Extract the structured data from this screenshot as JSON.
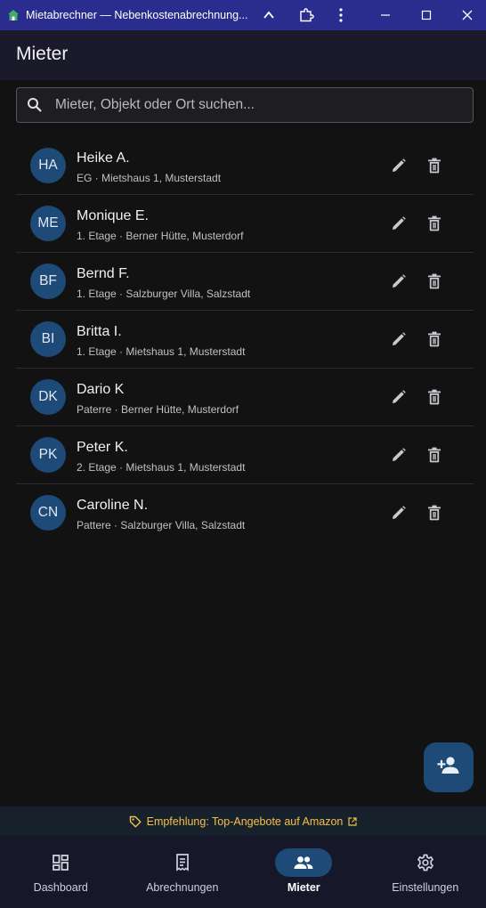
{
  "window": {
    "title": "Mietabrechner — Nebenkostenabrechnung...",
    "app_icon": "house-icon",
    "controls": [
      "chevron-up-icon",
      "extension-icon",
      "more-vert-icon",
      "minimize-icon",
      "maximize-icon",
      "close-icon"
    ]
  },
  "header": {
    "title": "Mieter"
  },
  "search": {
    "placeholder": "Mieter, Objekt oder Ort suchen...",
    "value": "",
    "icon": "search-icon"
  },
  "tenants": [
    {
      "initials": "HA",
      "name": "Heike A.",
      "details": "EG · Mietshaus 1, Musterstadt"
    },
    {
      "initials": "ME",
      "name": "Monique E.",
      "details": "1. Etage · Berner Hütte, Musterdorf"
    },
    {
      "initials": "BF",
      "name": "Bernd F.",
      "details": "1. Etage · Salzburger Villa, Salzstadt"
    },
    {
      "initials": "BI",
      "name": "Britta I.",
      "details": "1. Etage · Mietshaus 1, Musterstadt"
    },
    {
      "initials": "DK",
      "name": "Dario K",
      "details": "Paterre · Berner Hütte, Musterdorf"
    },
    {
      "initials": "PK",
      "name": "Peter K.",
      "details": "2. Etage · Mietshaus 1, Musterstadt"
    },
    {
      "initials": "CN",
      "name": "Caroline N.",
      "details": "Pattere · Salzburger Villa, Salzstadt"
    }
  ],
  "row_actions": {
    "edit_icon": "edit-icon",
    "delete_icon": "delete-icon"
  },
  "fab": {
    "icon": "person-add-icon"
  },
  "promo": {
    "text": "Empfehlung: Top-Angebote auf Amazon",
    "icon": "tag-icon",
    "link_icon": "external-link-icon"
  },
  "nav": {
    "items": [
      {
        "label": "Dashboard",
        "icon": "dashboard-icon",
        "active": false
      },
      {
        "label": "Abrechnungen",
        "icon": "receipt-icon",
        "active": false
      },
      {
        "label": "Mieter",
        "icon": "people-icon",
        "active": true
      },
      {
        "label": "Einstellungen",
        "icon": "settings-icon",
        "active": false
      }
    ]
  },
  "colors": {
    "titlebar": "#2b2d8e",
    "appbar": "#1a1a2a",
    "background": "#121212",
    "accent": "#1e4a78",
    "promo_text": "#f5c04a",
    "nav_background": "#17172a"
  }
}
